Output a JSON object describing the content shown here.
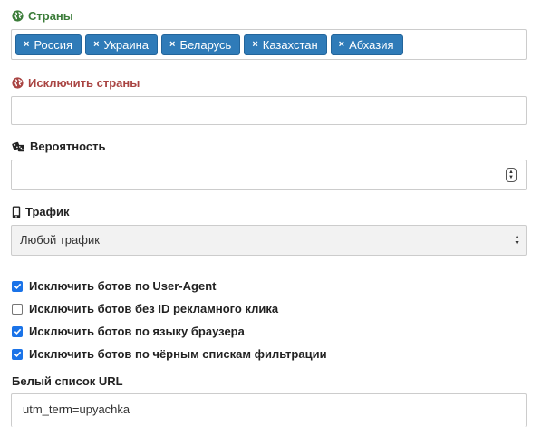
{
  "countries": {
    "label": "Страны",
    "icon": "globe-icon",
    "tags": [
      "Россия",
      "Украина",
      "Беларусь",
      "Казахстан",
      "Абхазия"
    ],
    "remove_glyph": "×"
  },
  "exclude_countries": {
    "label": "Исключить страны",
    "icon": "globe-icon",
    "value": ""
  },
  "probability": {
    "label": "Вероятность",
    "icon": "dice-icon",
    "value": ""
  },
  "traffic": {
    "label": "Трафик",
    "icon": "mobile-phone-icon",
    "selected": "Любой трафик"
  },
  "bots": [
    {
      "label": "Исключить ботов по User-Agent",
      "checked": true
    },
    {
      "label": "Исключить ботов без ID рекламного клика",
      "checked": false
    },
    {
      "label": "Исключить ботов по языку браузера",
      "checked": true
    },
    {
      "label": "Исключить ботов по чёрным спискам фильтрации",
      "checked": true
    }
  ],
  "whitelist": {
    "label": "Белый список URL",
    "value": "utm_term=upyachka"
  },
  "colors": {
    "accent_green": "#3c7d3a",
    "accent_red": "#a94442",
    "tag_blue": "#2f7bb8",
    "checkbox_blue": "#1a73e8"
  }
}
